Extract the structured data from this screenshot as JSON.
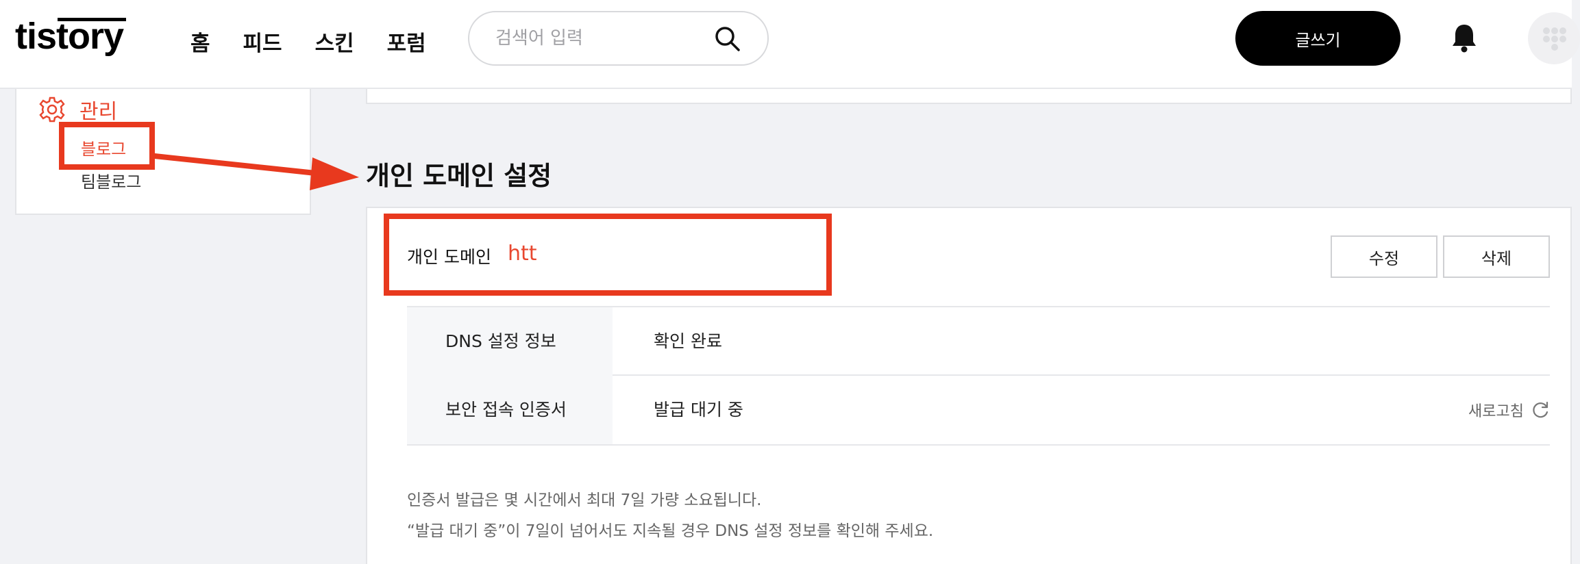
{
  "header": {
    "logo": "tistory",
    "nav": [
      "홈",
      "피드",
      "스킨",
      "포럼"
    ],
    "search": {
      "placeholder": "검색어 입력",
      "value": ""
    },
    "write_button": "글쓰기"
  },
  "sidebar": {
    "title": "관리",
    "items": [
      {
        "label": "블로그",
        "active": true
      },
      {
        "label": "팀블로그",
        "active": false
      }
    ]
  },
  "main": {
    "section_title": "개인 도메인 설정",
    "domain": {
      "label": "개인 도메인",
      "value": "htt",
      "edit_button": "수정",
      "delete_button": "삭제"
    },
    "info_rows": [
      {
        "label": "DNS 설정 정보",
        "value": "확인 완료"
      },
      {
        "label": "보안 접속 인증서",
        "value": "발급 대기 중",
        "action": "새로고침"
      }
    ],
    "notices": [
      "인증서 발급은 몇 시간에서 최대 7일 가량 소요됩니다.",
      "“발급 대기 중”이 7일이 넘어서도 지속될 경우 DNS 설정 정보를 확인해 주세요."
    ]
  },
  "colors": {
    "accent": "#e8472f",
    "annotation": "#e8391e",
    "background": "#f1f2f5",
    "button_dark": "#000000"
  },
  "icons": [
    "search-icon",
    "bell-icon",
    "gear-icon",
    "refresh-icon",
    "avatar"
  ]
}
